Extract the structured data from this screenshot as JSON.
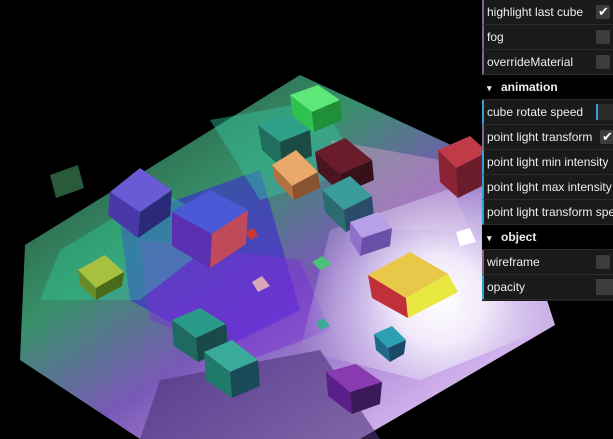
{
  "gui": {
    "controls_top": [
      {
        "label": "highlight last cube",
        "type": "boolean",
        "checked": true
      },
      {
        "label": "fog",
        "type": "boolean",
        "checked": false
      },
      {
        "label": "overrideMaterial",
        "type": "boolean",
        "checked": false
      }
    ],
    "animation_folder": {
      "title": "animation",
      "controls": [
        {
          "label": "cube rotate speed",
          "type": "number",
          "level": 0.05
        },
        {
          "label": "point light transform",
          "type": "boolean",
          "checked": true
        },
        {
          "label": "point light min intensity",
          "type": "number"
        },
        {
          "label": "point light max intensity",
          "type": "number"
        },
        {
          "label": "point light transform speed",
          "type": "number"
        }
      ]
    },
    "object_folder": {
      "title": "object",
      "controls": [
        {
          "label": "wireframe",
          "type": "boolean",
          "checked": false
        },
        {
          "label": "opacity",
          "type": "number"
        }
      ]
    },
    "colors": {
      "panel_bg": "#1a1a1a",
      "folder_bg": "#000000",
      "checkbox_bg": "#3c3c3c",
      "number_accent": "#2fa1d6",
      "boolean_accent": "#806787"
    },
    "icons": {
      "check": "✔",
      "chevron": "▾"
    }
  },
  "scene": {
    "background": "#000000",
    "light_color": "#ffffff"
  }
}
